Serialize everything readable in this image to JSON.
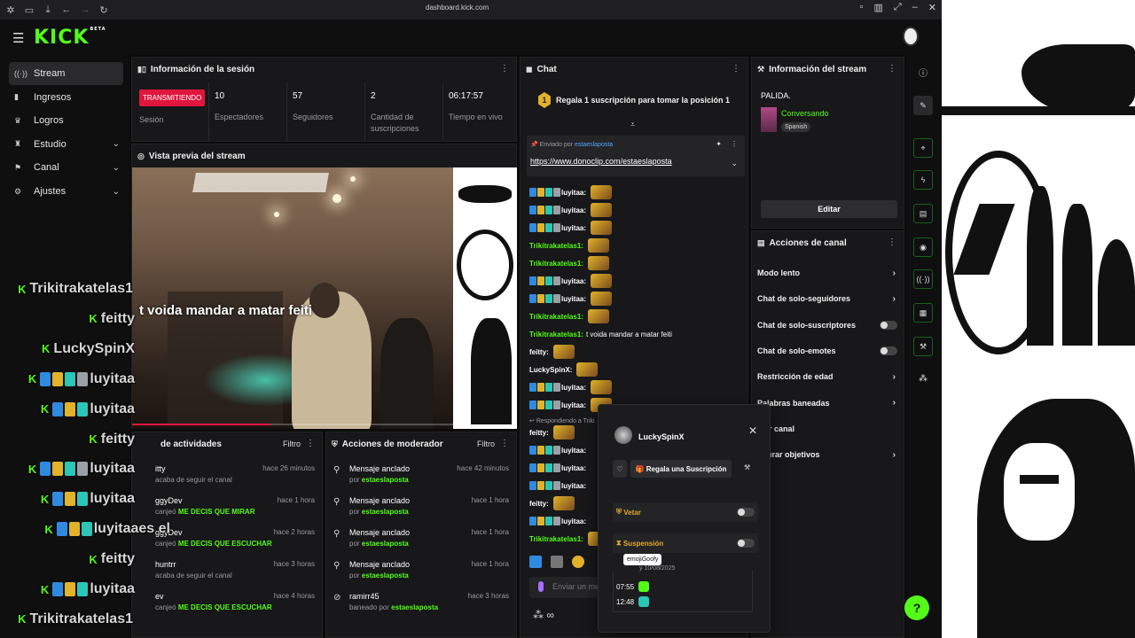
{
  "browser": {
    "url": "dashboard.kick.com"
  },
  "app": {
    "logo": "KICK",
    "logo_tag": "BETA"
  },
  "nav": [
    {
      "label": "Stream",
      "icon": "broadcast-icon",
      "active": true,
      "expandable": false
    },
    {
      "label": "Ingresos",
      "icon": "wallet-icon",
      "active": false,
      "expandable": false
    },
    {
      "label": "Logros",
      "icon": "trophy-icon",
      "active": false,
      "expandable": false
    },
    {
      "label": "Estudio",
      "icon": "studio-icon",
      "active": false,
      "expandable": true
    },
    {
      "label": "Canal",
      "icon": "channel-icon",
      "active": false,
      "expandable": true
    },
    {
      "label": "Ajustes",
      "icon": "gear-icon",
      "active": false,
      "expandable": true
    }
  ],
  "session": {
    "title": "Información de la sesión",
    "live_badge": "TRANSMITIENDO",
    "live_label": "Sesión",
    "stats": [
      {
        "value": "10",
        "label": "Espectadores"
      },
      {
        "value": "57",
        "label": "Seguidores"
      },
      {
        "value": "2",
        "label": "Cantidad de suscripciones"
      },
      {
        "value": "06:17:57",
        "label": "Tiempo en vivo"
      }
    ]
  },
  "preview": {
    "title": "Vista previa del stream",
    "subtitle": "t voida mandar a matar feiti",
    "progress": 0.43
  },
  "activity": {
    "title": "de actividades",
    "filter": "Filtro",
    "items": [
      {
        "name": "itty",
        "action": "acaba de seguir el canal",
        "highlight": "",
        "time": "hace 26 minutos"
      },
      {
        "name": "ggyDev",
        "action": "canjeó",
        "highlight": "ME DECIS QUE MIRAR",
        "time": "hace 1 hora"
      },
      {
        "name": "ggyDev",
        "action": "canjeó",
        "highlight": "ME DECIS QUE ESCUCHAR",
        "time": "hace 2 horas"
      },
      {
        "name": "huntrr",
        "action": "acaba de seguir el canal",
        "highlight": "",
        "time": "hace 3 horas"
      },
      {
        "name": "ev",
        "action": "canjeó",
        "highlight": "ME DECIS QUE ESCUCHAR",
        "time": "hace 4 horas"
      }
    ]
  },
  "mods": {
    "title": "Acciones de moderador",
    "filter": "Filtro",
    "items": [
      {
        "title": "Mensaje anclado",
        "by": "por",
        "who": "estaeslaposta",
        "time": "hace 42 minutos",
        "icon": "pin-icon"
      },
      {
        "title": "Mensaje anclado",
        "by": "por",
        "who": "estaeslaposta",
        "time": "hace 1 hora",
        "icon": "pin-icon"
      },
      {
        "title": "Mensaje anclado",
        "by": "por",
        "who": "estaeslaposta",
        "time": "hace 1 hora",
        "icon": "pin-icon"
      },
      {
        "title": "Mensaje anclado",
        "by": "por",
        "who": "estaeslaposta",
        "time": "hace 1 hora",
        "icon": "pin-icon"
      },
      {
        "title": "ramirr45",
        "by": "baneado por",
        "who": "estaeslaposta",
        "time": "hace 3 horas",
        "icon": "ban-icon"
      }
    ]
  },
  "chat": {
    "title": "Chat",
    "gift_medal": "1",
    "gift_text": "Regala 1 suscripción para tomar la posición 1",
    "pinned_by": "Enviado por",
    "pinned_user": "estaeslaposta",
    "pinned_link": "https://www.donoclip.com/estaeslaposta",
    "messages": [
      {
        "user": "luyitaa:",
        "green": false,
        "text": "",
        "badges": 4,
        "emote": true
      },
      {
        "user": "luyitaa:",
        "green": false,
        "text": "",
        "badges": 4,
        "emote": true
      },
      {
        "user": "luyitaa:",
        "green": false,
        "text": "",
        "badges": 4,
        "emote": true
      },
      {
        "user": "Trikitrakatelas1:",
        "green": true,
        "text": "",
        "badges": 0,
        "emote": true
      },
      {
        "user": "Trikitrakatelas1:",
        "green": true,
        "text": "",
        "badges": 0,
        "emote": true
      },
      {
        "user": "luyitaa:",
        "green": false,
        "text": "",
        "badges": 4,
        "emote": true
      },
      {
        "user": "luyitaa:",
        "green": false,
        "text": "",
        "badges": 4,
        "emote": true
      },
      {
        "user": "Trikitrakatelas1:",
        "green": true,
        "text": "",
        "badges": 0,
        "emote": true
      },
      {
        "user": "Trikitrakatelas1:",
        "green": true,
        "text": "t voida mandar a matar feiti",
        "badges": 0,
        "emote": false
      },
      {
        "user": "feitty:",
        "green": false,
        "text": "",
        "badges": 0,
        "emote": true
      },
      {
        "user": "LuckySpinX:",
        "green": false,
        "text": "",
        "badges": 0,
        "emote": true
      },
      {
        "user": "luyitaa:",
        "green": false,
        "text": "",
        "badges": 4,
        "emote": true
      },
      {
        "user": "luyitaa:",
        "green": false,
        "text": "",
        "badges": 4,
        "emote": true
      }
    ],
    "reply_context": "Respondiendo a Triki",
    "messages2": [
      {
        "user": "feitty:",
        "green": false,
        "text": "",
        "badges": 0,
        "emote": true
      },
      {
        "user": "luyitaa:",
        "green": false,
        "text": "",
        "badges": 4,
        "emote": false
      },
      {
        "user": "luyitaa:",
        "green": false,
        "text": "",
        "badges": 4,
        "emote": false
      },
      {
        "user": "luyitaa:",
        "green": false,
        "text": "",
        "badges": 4,
        "emote": false
      },
      {
        "user": "feitty:",
        "green": false,
        "text": "",
        "badges": 0,
        "emote": true
      },
      {
        "user": "luyitaa:",
        "green": false,
        "text": "",
        "badges": 4,
        "emote": false
      },
      {
        "user": "Trikitrakatelas1:",
        "green": true,
        "text": "",
        "badges": 0,
        "emote": true
      }
    ],
    "input_placeholder": "Enviar un me",
    "infinity": "∞"
  },
  "stream_info": {
    "title": "Información del stream",
    "stream_title": "PALIDA.",
    "category": "Conversando",
    "language": "Spanish",
    "edit": "Editar"
  },
  "channel_actions": {
    "title": "Acciones de canal",
    "rows": [
      {
        "label": "Modo lento",
        "kind": "arrow"
      },
      {
        "label": "Chat de solo-seguidores",
        "kind": "arrow"
      },
      {
        "label": "Chat de solo-suscriptores",
        "kind": "toggle"
      },
      {
        "label": "Chat de solo-emotes",
        "kind": "toggle"
      },
      {
        "label": "Restricción de edad",
        "kind": "arrow"
      },
      {
        "label": "Palabras baneadas",
        "kind": "arrow"
      },
      {
        "label": "tear canal",
        "kind": "none"
      },
      {
        "label": "figurar objetivos",
        "kind": "arrow"
      }
    ]
  },
  "user_popup": {
    "name": "LuckySpinX",
    "gift": "Regala una Suscripción",
    "veto": "Vetar",
    "suspension": "Suspensión",
    "date": "y 10/08/2025",
    "tooltip": "emojiGoofy",
    "log": [
      {
        "time": "07:55"
      },
      {
        "time": "12:48"
      }
    ]
  },
  "overlay": [
    {
      "user": "Trikitrakatelas1",
      "badges": 0,
      "suffix": ""
    },
    {
      "user": "feitty",
      "badges": 0,
      "suffix": ""
    },
    {
      "user": "LuckySpinX",
      "badges": 0,
      "suffix": ""
    },
    {
      "user": "luyitaa",
      "badges": 4,
      "suffix": ""
    },
    {
      "user": "luyitaa",
      "badges": 3,
      "suffix": ""
    },
    {
      "user": "feitty",
      "badges": 0,
      "suffix": ""
    },
    {
      "user": "luyitaa",
      "badges": 4,
      "suffix": ""
    },
    {
      "user": "luyitaa",
      "badges": 3,
      "suffix": ""
    },
    {
      "user": "luyitaa",
      "badges": 3,
      "suffix": " es el"
    },
    {
      "user": "feitty",
      "badges": 0,
      "suffix": ""
    },
    {
      "user": "luyitaa",
      "badges": 3,
      "suffix": ""
    },
    {
      "user": "Trikitrakatelas1",
      "badges": 0,
      "suffix": ""
    }
  ],
  "colors": {
    "accent": "#53fc18",
    "live": "#e0163e",
    "panel": "#18181a",
    "badge_blue": "#2f8ae0",
    "badge_yellow": "#e3b22b",
    "badge_teal": "#2bc6b5"
  }
}
